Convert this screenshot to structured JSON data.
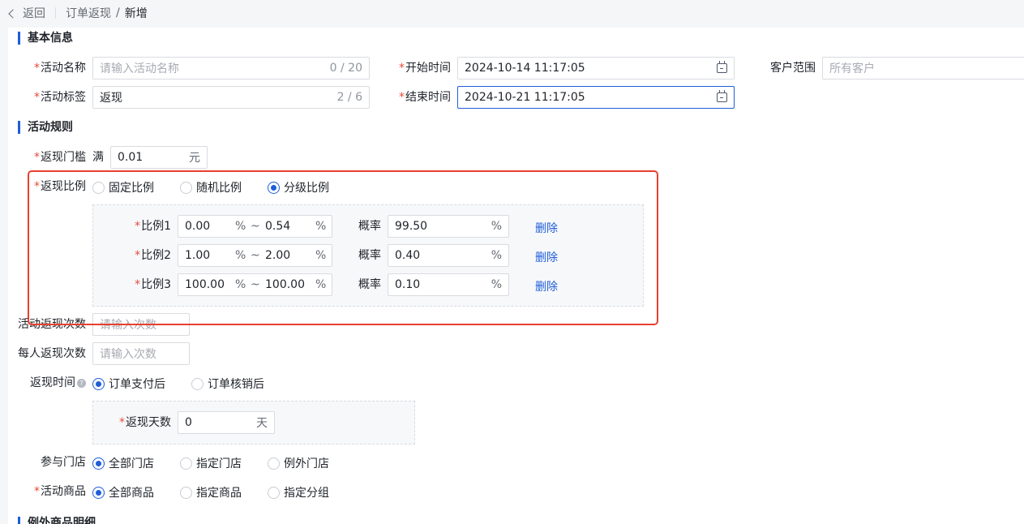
{
  "header": {
    "back_label": "返回",
    "breadcrumb_parent": "订单返现",
    "breadcrumb_separator": "/",
    "breadcrumb_current": "新增"
  },
  "basic": {
    "section_title": "基本信息",
    "name_label": "活动名称",
    "name_placeholder": "请输入活动名称",
    "name_count": "0 / 20",
    "tag_label": "活动标签",
    "tag_value": "返现",
    "tag_count": "2 / 6",
    "start_label": "开始时间",
    "start_value": "2024-10-14 11:17:05",
    "end_label": "结束时间",
    "end_value": "2024-10-21 11:17:05",
    "customer_label": "客户范围",
    "customer_placeholder": "所有客户"
  },
  "rules": {
    "section_title": "活动规则",
    "threshold_label": "返现门槛",
    "threshold_prefix": "满",
    "threshold_value": "0.01",
    "threshold_unit": "元",
    "ratio_label": "返现比例",
    "ratio_options": [
      "固定比例",
      "随机比例",
      "分级比例"
    ],
    "ratio_selected": 2,
    "tiers": [
      {
        "label": "比例1",
        "from": "0.00",
        "to": "0.54",
        "prob": "99.50"
      },
      {
        "label": "比例2",
        "from": "1.00",
        "to": "2.00",
        "prob": "0.40"
      },
      {
        "label": "比例3",
        "from": "100.00",
        "to": "100.00",
        "prob": "0.10"
      }
    ],
    "percent_sign": "%",
    "tilde": "~",
    "prob_label": "概率",
    "delete_label": "删除",
    "total_times_label": "活动返现次数",
    "total_times_placeholder": "请输入次数",
    "per_person_label": "每人返现次数",
    "per_person_placeholder": "请输入次数",
    "cashback_time_label": "返现时间",
    "help_icon_glyph": "?",
    "cashback_time_options": [
      "订单支付后",
      "订单核销后"
    ],
    "days_label": "返现天数",
    "days_value": "0",
    "days_unit": "天",
    "store_label": "参与门店",
    "store_options": [
      "全部门店",
      "指定门店",
      "例外门店"
    ],
    "goods_label": "活动商品",
    "goods_options": [
      "全部商品",
      "指定商品",
      "指定分组"
    ]
  },
  "exception": {
    "section_title": "例外商品明细"
  },
  "colors": {
    "primary": "#1f5ed8",
    "required": "#e64a3b",
    "highlight_box": "#e8402e"
  }
}
